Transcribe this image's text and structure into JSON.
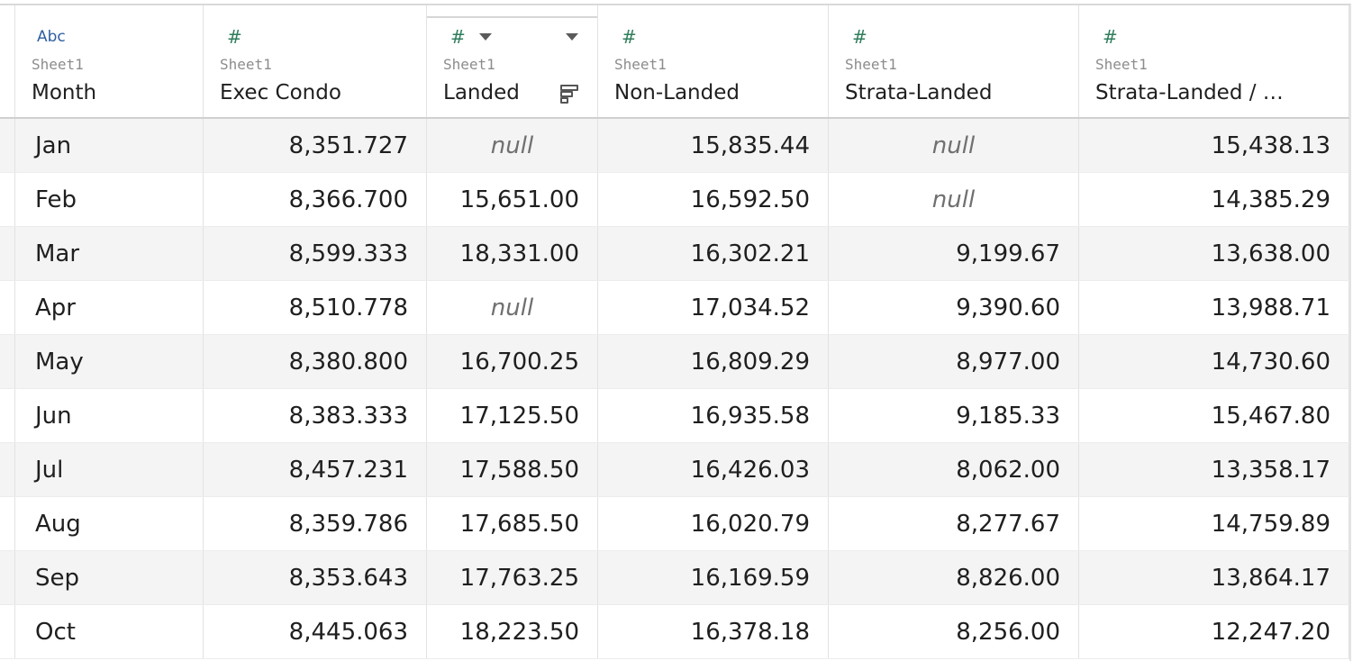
{
  "columns": [
    {
      "type_icon": "Abc",
      "type_icon_name": "string-type-icon",
      "source": "Sheet1",
      "name": "Month"
    },
    {
      "type_icon": "#",
      "type_icon_name": "number-type-icon",
      "source": "Sheet1",
      "name": "Exec Condo"
    },
    {
      "type_icon": "#",
      "type_icon_name": "number-type-icon",
      "source": "Sheet1",
      "name": "Landed"
    },
    {
      "type_icon": "#",
      "type_icon_name": "number-type-icon",
      "source": "Sheet1",
      "name": "Non-Landed"
    },
    {
      "type_icon": "#",
      "type_icon_name": "number-type-icon",
      "source": "Sheet1",
      "name": "Strata-Landed"
    },
    {
      "type_icon": "#",
      "type_icon_name": "number-type-icon",
      "source": "Sheet1",
      "name": "Strata-Landed / …"
    }
  ],
  "rows": [
    [
      "Jan",
      "8,351.727",
      "null",
      "15,835.44",
      "null",
      "15,438.13"
    ],
    [
      "Feb",
      "8,366.700",
      "15,651.00",
      "16,592.50",
      "null",
      "14,385.29"
    ],
    [
      "Mar",
      "8,599.333",
      "18,331.00",
      "16,302.21",
      "9,199.67",
      "13,638.00"
    ],
    [
      "Apr",
      "8,510.778",
      "null",
      "17,034.52",
      "9,390.60",
      "13,988.71"
    ],
    [
      "May",
      "8,380.800",
      "16,700.25",
      "16,809.29",
      "8,977.00",
      "14,730.60"
    ],
    [
      "Jun",
      "8,383.333",
      "17,125.50",
      "16,935.58",
      "9,185.33",
      "15,467.80"
    ],
    [
      "Jul",
      "8,457.231",
      "17,588.50",
      "16,426.03",
      "8,062.00",
      "13,358.17"
    ],
    [
      "Aug",
      "8,359.786",
      "17,685.50",
      "16,020.79",
      "8,277.67",
      "14,759.89"
    ],
    [
      "Sep",
      "8,353.643",
      "17,763.25",
      "16,169.59",
      "8,826.00",
      "13,864.17"
    ],
    [
      "Oct",
      "8,445.063",
      "18,223.50",
      "16,378.18",
      "8,256.00",
      "12,247.20"
    ]
  ],
  "colors": {
    "number_type": "#2e7d5b",
    "string_type": "#2f5fa0",
    "alt_row": "#f4f4f4",
    "null_text": "#707070"
  }
}
